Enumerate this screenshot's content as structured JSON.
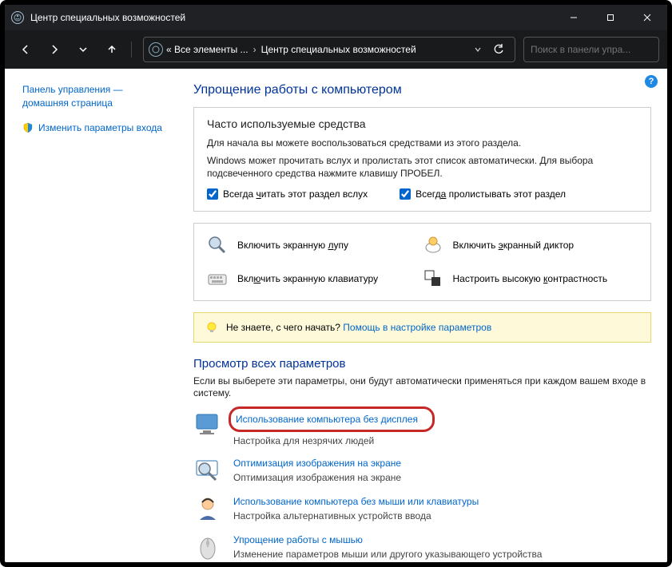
{
  "titlebar": {
    "title": "Центр специальных возможностей"
  },
  "nav": {
    "bc_root": "« Все элементы ...",
    "bc_current": "Центр специальных возможностей",
    "search_placeholder": "Поиск в панели упра..."
  },
  "sidebar": {
    "home1": "Панель управления —",
    "home2": "домашняя страница",
    "login": "Изменить параметры входа"
  },
  "main": {
    "heading": "Упрощение работы с компьютером",
    "tools_heading": "Часто используемые средства",
    "tools_p1": "Для начала вы можете воспользоваться средствами из этого раздела.",
    "tools_p2": "Windows может прочитать вслух и пролистать этот список автоматически. Для выбора подсвеченного средства нажмите клавишу ПРОБЕЛ.",
    "chk_read": "Всегда читать этот раздел вслух",
    "chk_scroll": "Всегда пролистывать этот раздел",
    "grid": {
      "magnifier": "Включить экранную лупу",
      "narrator": "Включить экранный диктор",
      "keyboard": "Включить экранную клавиатуру",
      "contrast": "Настроить высокую контрастность"
    },
    "hint_q": "Не знаете, с чего начать? ",
    "hint_link": "Помощь в настройке параметров",
    "all_heading": "Просмотр всех параметров",
    "all_desc": "Если вы выберете эти параметры, они будут автоматически применяться при каждом вашем входе в систему.",
    "opts": [
      {
        "link": "Использование компьютера без дисплея",
        "sub": "Настройка для незрячих людей"
      },
      {
        "link": "Оптимизация изображения на экране",
        "sub": "Оптимизация изображения на экране"
      },
      {
        "link": "Использование компьютера без мыши или клавиатуры",
        "sub": "Настройка альтернативных устройств ввода"
      },
      {
        "link": "Упрощение работы с мышью",
        "sub": "Изменение параметров мыши или другого указывающего устройства"
      }
    ]
  }
}
